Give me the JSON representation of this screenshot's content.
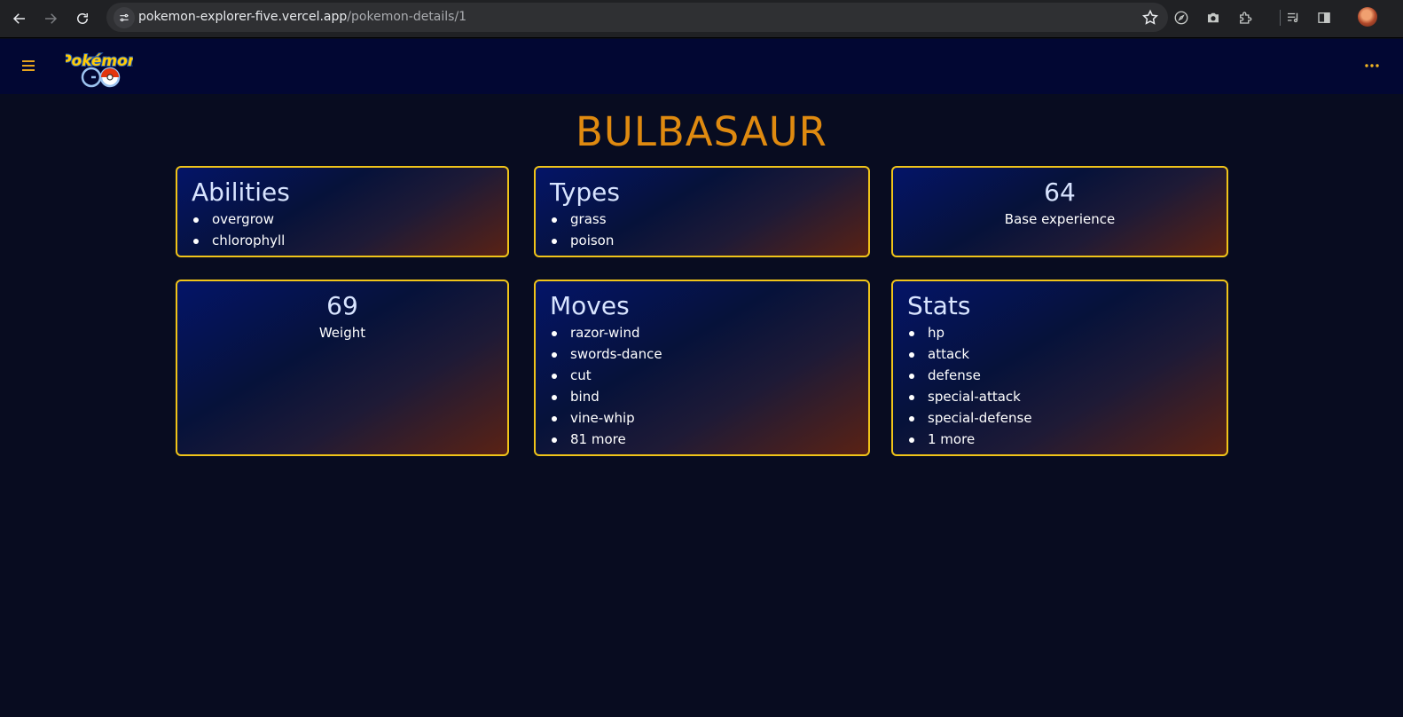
{
  "browser": {
    "url_host": "pokemon-explorer-five.vercel.app",
    "url_path": "/pokemon-details/1"
  },
  "app": {
    "logo": "Pokémon GO"
  },
  "pokemon": {
    "name": "BULBASAUR",
    "abilities": {
      "title": "Abilities",
      "items": [
        "overgrow",
        "chlorophyll"
      ]
    },
    "types": {
      "title": "Types",
      "items": [
        "grass",
        "poison"
      ]
    },
    "base_experience": {
      "value": "64",
      "label": "Base experience"
    },
    "weight": {
      "value": "69",
      "label": "Weight"
    },
    "moves": {
      "title": "Moves",
      "items": [
        "razor-wind",
        "swords-dance",
        "cut",
        "bind",
        "vine-whip",
        "81 more"
      ]
    },
    "stats": {
      "title": "Stats",
      "items": [
        "hp",
        "attack",
        "defense",
        "special-attack",
        "special-defense",
        "1 more"
      ]
    }
  },
  "colors": {
    "accent": "#df8a10",
    "card_border": "#f0c419",
    "header_bg": "#020733",
    "page_bg": "#080c20"
  }
}
